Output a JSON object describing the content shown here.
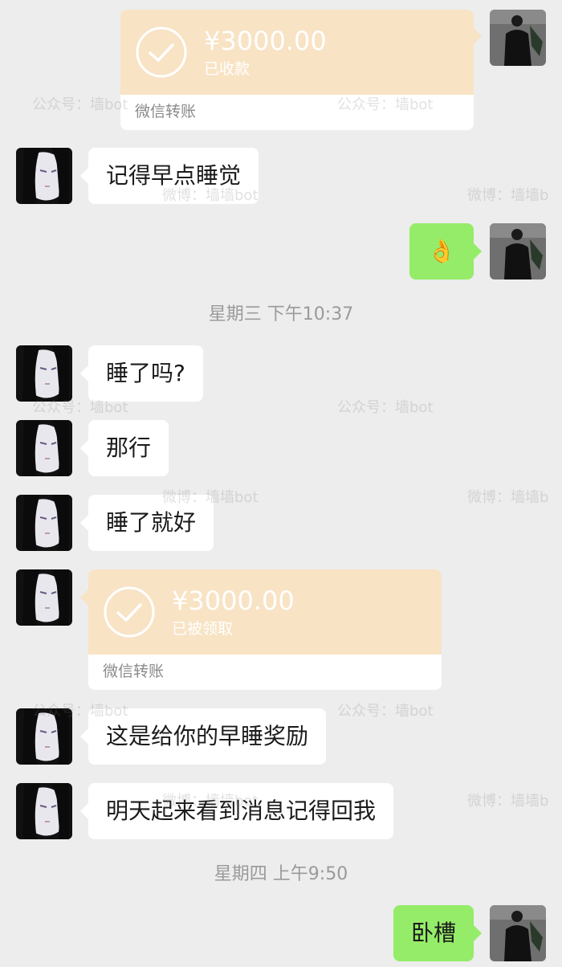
{
  "messages": {
    "top_transfer": {
      "amount": "¥3000.00",
      "status": "已收款",
      "label": "微信转账"
    },
    "m1": "记得早点睡觉",
    "ok_emoji": "👌",
    "time1": "星期三 下午10:37",
    "m2": "睡了吗?",
    "m3": "那行",
    "m4": "睡了就好",
    "left_transfer": {
      "amount": "¥3000.00",
      "status": "已被领取",
      "label": "微信转账"
    },
    "m5": "这是给你的早睡奖励",
    "m6": "明天起来看到消息记得回我",
    "time2": "星期四 上午9:50",
    "m7": "卧槽"
  },
  "watermarks": {
    "gzh": "公众号：墙bot",
    "weibo": "微博：墙墙bot",
    "weibo_cut": "微博：墙墙b"
  },
  "colors": {
    "background": "#ededed",
    "self_bubble": "#95ec69",
    "other_bubble": "#ffffff",
    "transfer_top": "#f8e3c5",
    "timestamp": "#9a9a9a"
  }
}
